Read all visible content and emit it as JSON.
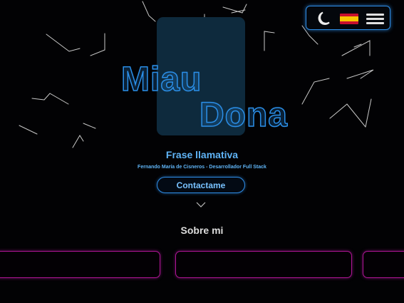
{
  "header": {
    "theme_toggle_icon": "moon-icon",
    "language_icon": "spain-flag-icon",
    "menu_icon": "hamburger-menu-icon"
  },
  "hero": {
    "name_line1": "Miau",
    "name_line2": "Dona",
    "tagline": "Frase llamativa",
    "subtitle": "Fernando María de Cisneros - Desarrollador Full Stack",
    "contact_label": "Contactame",
    "scroll_icon": "chevron-down-icon"
  },
  "about": {
    "title": "Sobre mi",
    "cards": 3
  },
  "colors": {
    "background": "#020204",
    "accent_blue": "#2e8ce6",
    "text_blue": "#5fb4f6",
    "accent_magenta": "#b01596"
  }
}
